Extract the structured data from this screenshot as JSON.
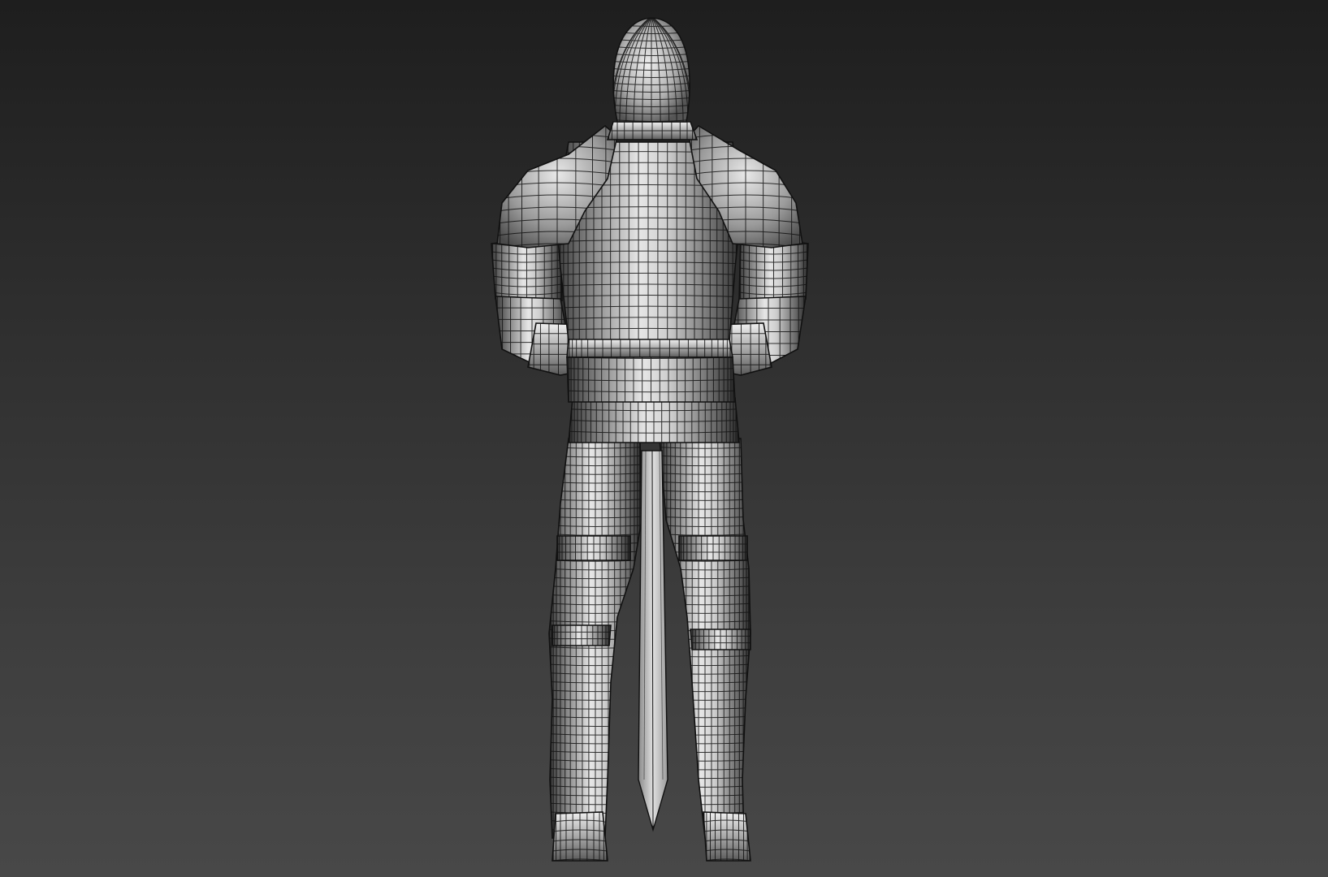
{
  "viewport": {
    "background_top": "#1e1e1e",
    "background_bottom": "#484848",
    "wire_color": "#111111",
    "shading": "smooth-highlights-plus-edged-faces"
  },
  "model": {
    "subject": "armored-knight-back-view",
    "icon": "knight-mesh-icon",
    "parts": [
      "helmet",
      "pauldrons",
      "back-plate",
      "arms",
      "gauntlets",
      "belt",
      "tassets",
      "legs",
      "sword-blade",
      "boots"
    ]
  }
}
